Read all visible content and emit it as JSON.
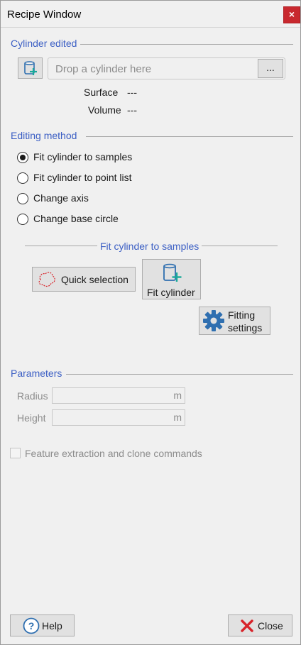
{
  "window": {
    "title": "Recipe Window",
    "close_glyph": "×"
  },
  "cylinder_section": {
    "heading": "Cylinder edited",
    "drop_placeholder": "Drop a cylinder here",
    "browse_label": "...",
    "surface_label": "Surface",
    "surface_value": "---",
    "volume_label": "Volume",
    "volume_value": "---"
  },
  "editing_method": {
    "heading": "Editing method",
    "options": [
      {
        "label": "Fit cylinder to samples",
        "checked": true
      },
      {
        "label": "Fit cylinder to point list",
        "checked": false
      },
      {
        "label": "Change axis",
        "checked": false
      },
      {
        "label": "Change base circle",
        "checked": false
      }
    ]
  },
  "fit_panel": {
    "heading": "Fit cylinder to samples",
    "quick_selection_label": "Quick selection",
    "fit_cylinder_label": "Fit cylinder",
    "fitting_settings_line1": "Fitting",
    "fitting_settings_line2": "settings"
  },
  "parameters": {
    "heading": "Parameters",
    "radius_label": "Radius",
    "radius_unit": "m",
    "height_label": "Height",
    "height_unit": "m"
  },
  "options": {
    "feature_extraction_label": "Feature extraction and clone commands",
    "feature_extraction_checked": false
  },
  "footer": {
    "help_label": "Help",
    "close_label": "Close"
  },
  "colors": {
    "accent": "#3c5fc4",
    "close_red": "#d8232a",
    "icon_blue": "#2f6fb0",
    "icon_teal": "#1aa99a"
  },
  "icons": {
    "add_cylinder": "add-cylinder-icon",
    "quick_selection": "lasso-selection-icon",
    "fit_cylinder": "fit-cylinder-icon",
    "settings": "gear-icon",
    "help": "help-circle-icon",
    "close": "red-x-icon"
  }
}
